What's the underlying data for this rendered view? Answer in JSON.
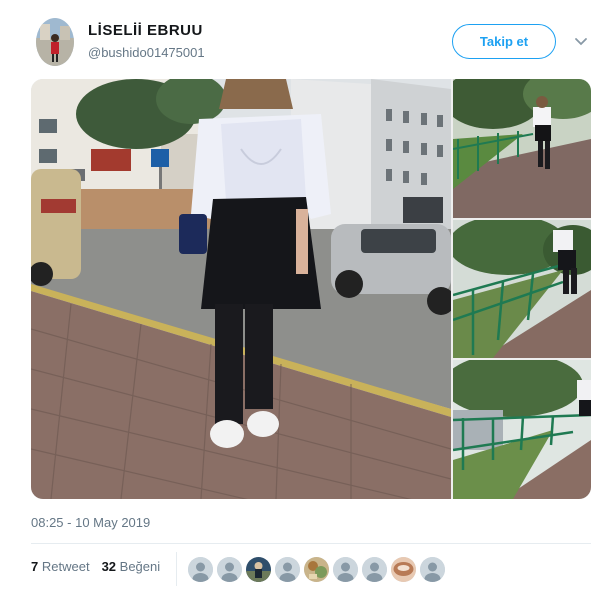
{
  "user": {
    "display_name": "LİSELİİ EBRUU",
    "handle": "@bushido01475001"
  },
  "actions": {
    "follow_label": "Takip et",
    "menu_icon": "chevron-down-icon"
  },
  "photos": [
    {
      "description": "main"
    },
    {
      "description": "side-1"
    },
    {
      "description": "side-2"
    },
    {
      "description": "side-3"
    }
  ],
  "timestamp": "08:25 - 10 May 2019",
  "stats": {
    "retweet_count": "7",
    "retweet_label": "Retweet",
    "like_count": "32",
    "like_label": "Beğeni"
  },
  "likers": [
    {
      "icon": "default-avatar-icon"
    },
    {
      "icon": "default-avatar-icon"
    },
    {
      "icon": "photo-avatar-icon"
    },
    {
      "icon": "default-avatar-icon"
    },
    {
      "icon": "photo-avatar-icon"
    },
    {
      "icon": "default-avatar-icon"
    },
    {
      "icon": "default-avatar-icon"
    },
    {
      "icon": "photo-avatar-icon"
    },
    {
      "icon": "default-avatar-icon"
    }
  ],
  "colors": {
    "accent": "#1da1f2",
    "secondary_text": "#657786",
    "primary_text": "#14171a"
  }
}
